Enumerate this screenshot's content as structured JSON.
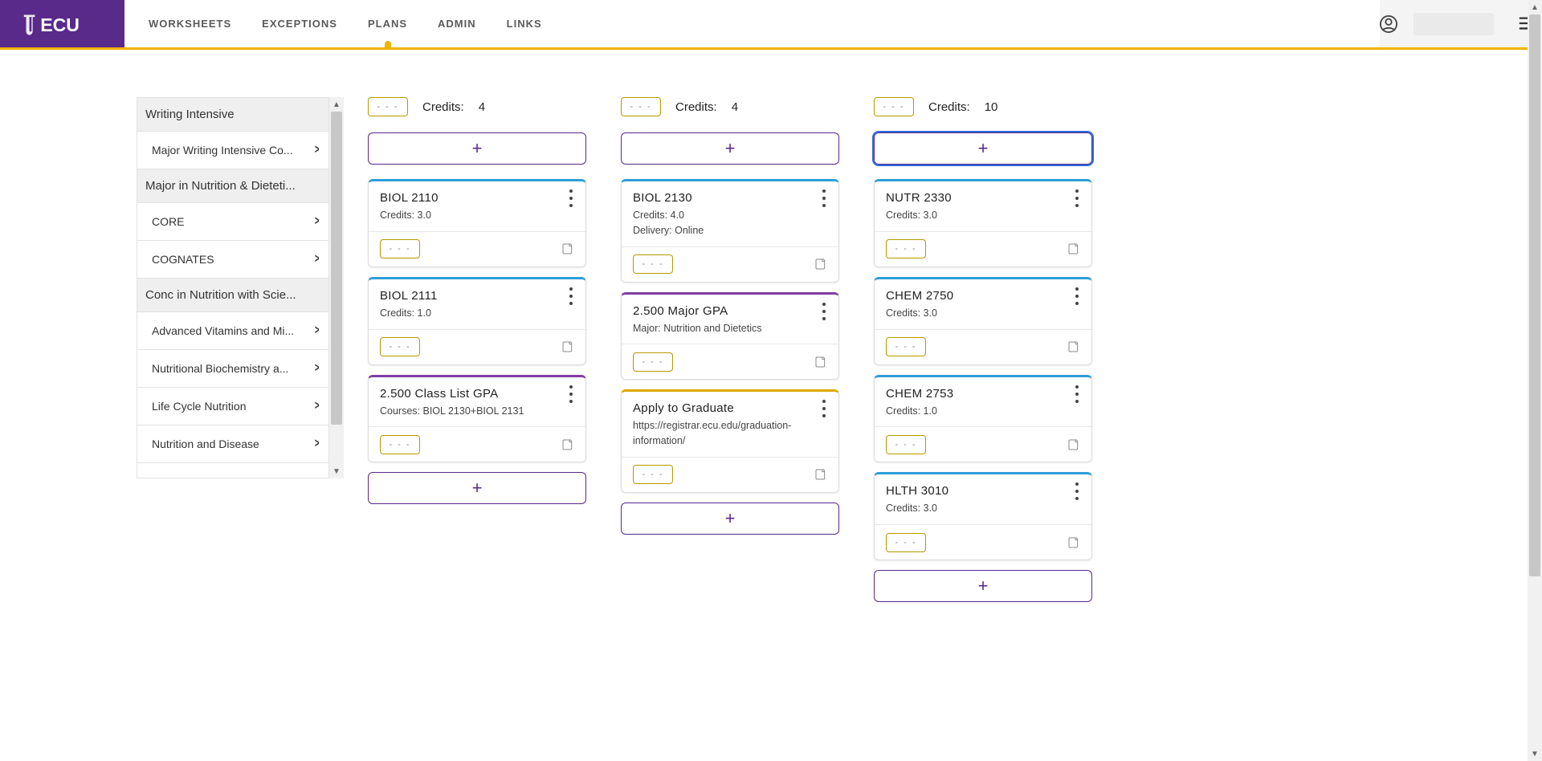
{
  "brand": "ECU",
  "nav": {
    "worksheets": "WORKSHEETS",
    "exceptions": "EXCEPTIONS",
    "plans": "PLANS",
    "admin": "ADMIN",
    "links": "LINKS",
    "active": "plans"
  },
  "sidebar": {
    "groups": [
      {
        "type": "head",
        "label": "Writing Intensive"
      },
      {
        "type": "item",
        "label": "Major Writing Intensive Co..."
      },
      {
        "type": "head",
        "label": "Major in Nutrition & Dieteti..."
      },
      {
        "type": "item",
        "label": "CORE"
      },
      {
        "type": "item",
        "label": "COGNATES"
      },
      {
        "type": "head",
        "label": "Conc in Nutrition with Scie..."
      },
      {
        "type": "item",
        "label": "Advanced Vitamins and Mi..."
      },
      {
        "type": "item",
        "label": "Nutritional Biochemistry a..."
      },
      {
        "type": "item",
        "label": "Life Cycle Nutrition"
      },
      {
        "type": "item",
        "label": "Nutrition and Disease"
      }
    ]
  },
  "columns": [
    {
      "credits_label": "Credits:",
      "credits_value": "4",
      "add_focused": false,
      "cards": [
        {
          "style": "blue",
          "title": "BIOL 2110",
          "lines": [
            "Credits: 3.0"
          ]
        },
        {
          "style": "blue",
          "title": "BIOL 2111",
          "lines": [
            "Credits: 1.0"
          ]
        },
        {
          "style": "purple",
          "title": "2.500 Class List GPA",
          "lines": [
            "Courses: BIOL 2130+BIOL 2131"
          ]
        }
      ],
      "trailing_add": true
    },
    {
      "credits_label": "Credits:",
      "credits_value": "4",
      "add_focused": false,
      "cards": [
        {
          "style": "blue",
          "title": "BIOL 2130",
          "lines": [
            "Credits: 4.0",
            "Delivery: Online"
          ]
        },
        {
          "style": "purple",
          "title": "2.500 Major GPA",
          "lines": [
            "Major: Nutrition and Dietetics"
          ]
        },
        {
          "style": "gold",
          "title": "Apply to Graduate",
          "lines": [
            "https://registrar.ecu.edu/graduation-information/"
          ]
        }
      ],
      "trailing_add": true
    },
    {
      "credits_label": "Credits:",
      "credits_value": "10",
      "add_focused": true,
      "cards": [
        {
          "style": "blue",
          "title": "NUTR 2330",
          "lines": [
            "Credits: 3.0"
          ]
        },
        {
          "style": "blue",
          "title": "CHEM 2750",
          "lines": [
            "Credits: 3.0"
          ]
        },
        {
          "style": "blue",
          "title": "CHEM 2753",
          "lines": [
            "Credits: 1.0"
          ]
        },
        {
          "style": "blue",
          "title": "HLTH 3010",
          "lines": [
            "Credits: 3.0"
          ]
        }
      ],
      "trailing_add": true
    }
  ]
}
